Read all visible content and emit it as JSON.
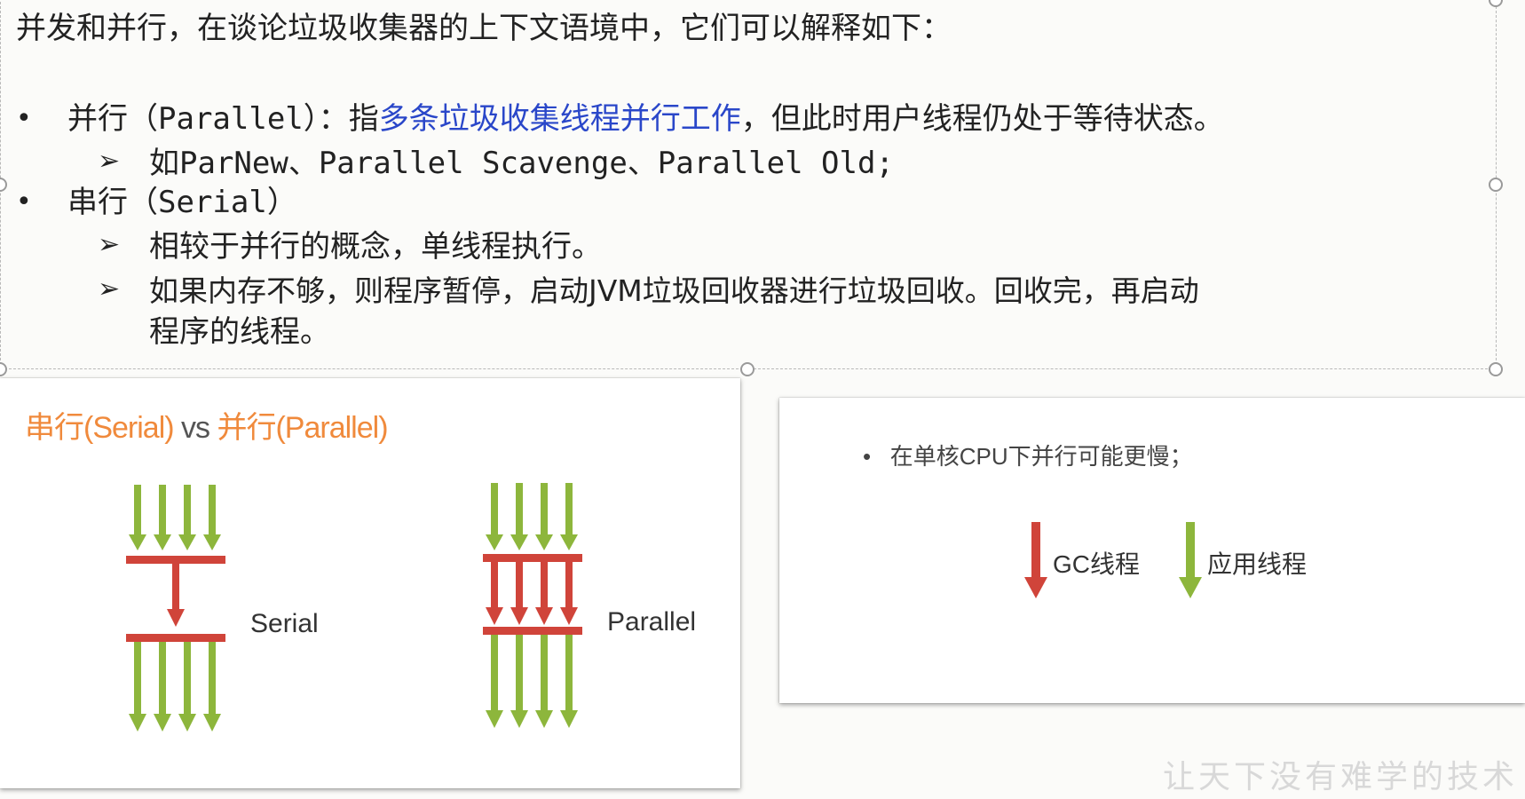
{
  "intro": "并发和并行，在谈论垃圾收集器的上下文语境中，它们可以解释如下：",
  "parallel": {
    "prefix": "并行",
    "term": "（Parallel）：",
    "mid": "指",
    "highlight": "多条垃圾收集线程并行工作",
    "suffix": "，但此时用户线程仍处于等待状态。",
    "examples_prefix": "如",
    "examples": "ParNew、Parallel Scavenge、Parallel Old;"
  },
  "serial": {
    "prefix": "串行",
    "term": "（Serial）",
    "sub1": "相较于并行的概念，单线程执行。",
    "sub2_line1": "如果内存不够，则程序暂停，启动JVM垃圾回收器进行垃圾回收。回收完，再启动",
    "sub2_line2": "程序的线程。"
  },
  "left_panel": {
    "title_part1": "串行(Serial)",
    "title_vs": " vs ",
    "title_part2": "并行(Parallel)",
    "serial_label": "Serial",
    "parallel_label": "Parallel"
  },
  "right_panel": {
    "bullet": "在单核CPU下并行可能更慢；",
    "legend_gc": "GC线程",
    "legend_app": "应用线程"
  },
  "watermark": "让天下没有难学的技术",
  "colors": {
    "green_arrow": "#8db63c",
    "red_arrow": "#d0443a",
    "orange_title": "#f08a3c",
    "highlight_blue": "#2a47c9"
  }
}
